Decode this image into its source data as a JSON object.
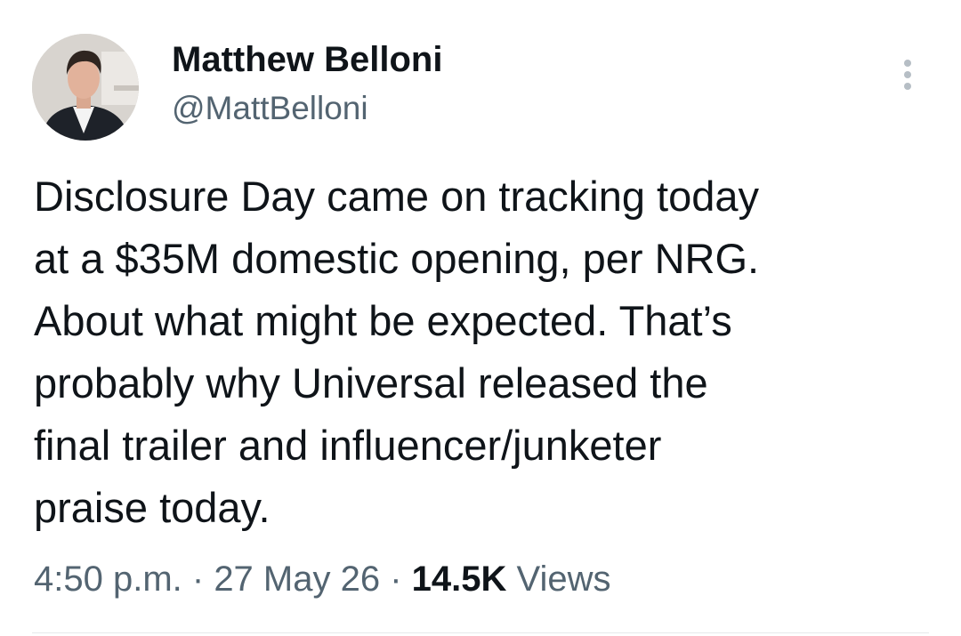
{
  "author": {
    "display_name": "Matthew Belloni",
    "handle": "@MattBelloni"
  },
  "tweet": {
    "text_lines": [
      "Disclosure Day came on tracking today",
      "at a $35M domestic opening, per NRG.",
      "About what might be expected. That’s",
      "probably why Universal released the",
      "final trailer and influencer/junketer",
      "praise today."
    ]
  },
  "meta": {
    "time": "4:50 p.m.",
    "separator": " · ",
    "date": "27 May 26",
    "views_count": "14.5K",
    "views_label": " Views"
  },
  "icons": {
    "more": "more-vertical-icon"
  },
  "colors": {
    "text": "#0f1419",
    "secondary": "#536471",
    "divider": "#e6e9eb"
  }
}
